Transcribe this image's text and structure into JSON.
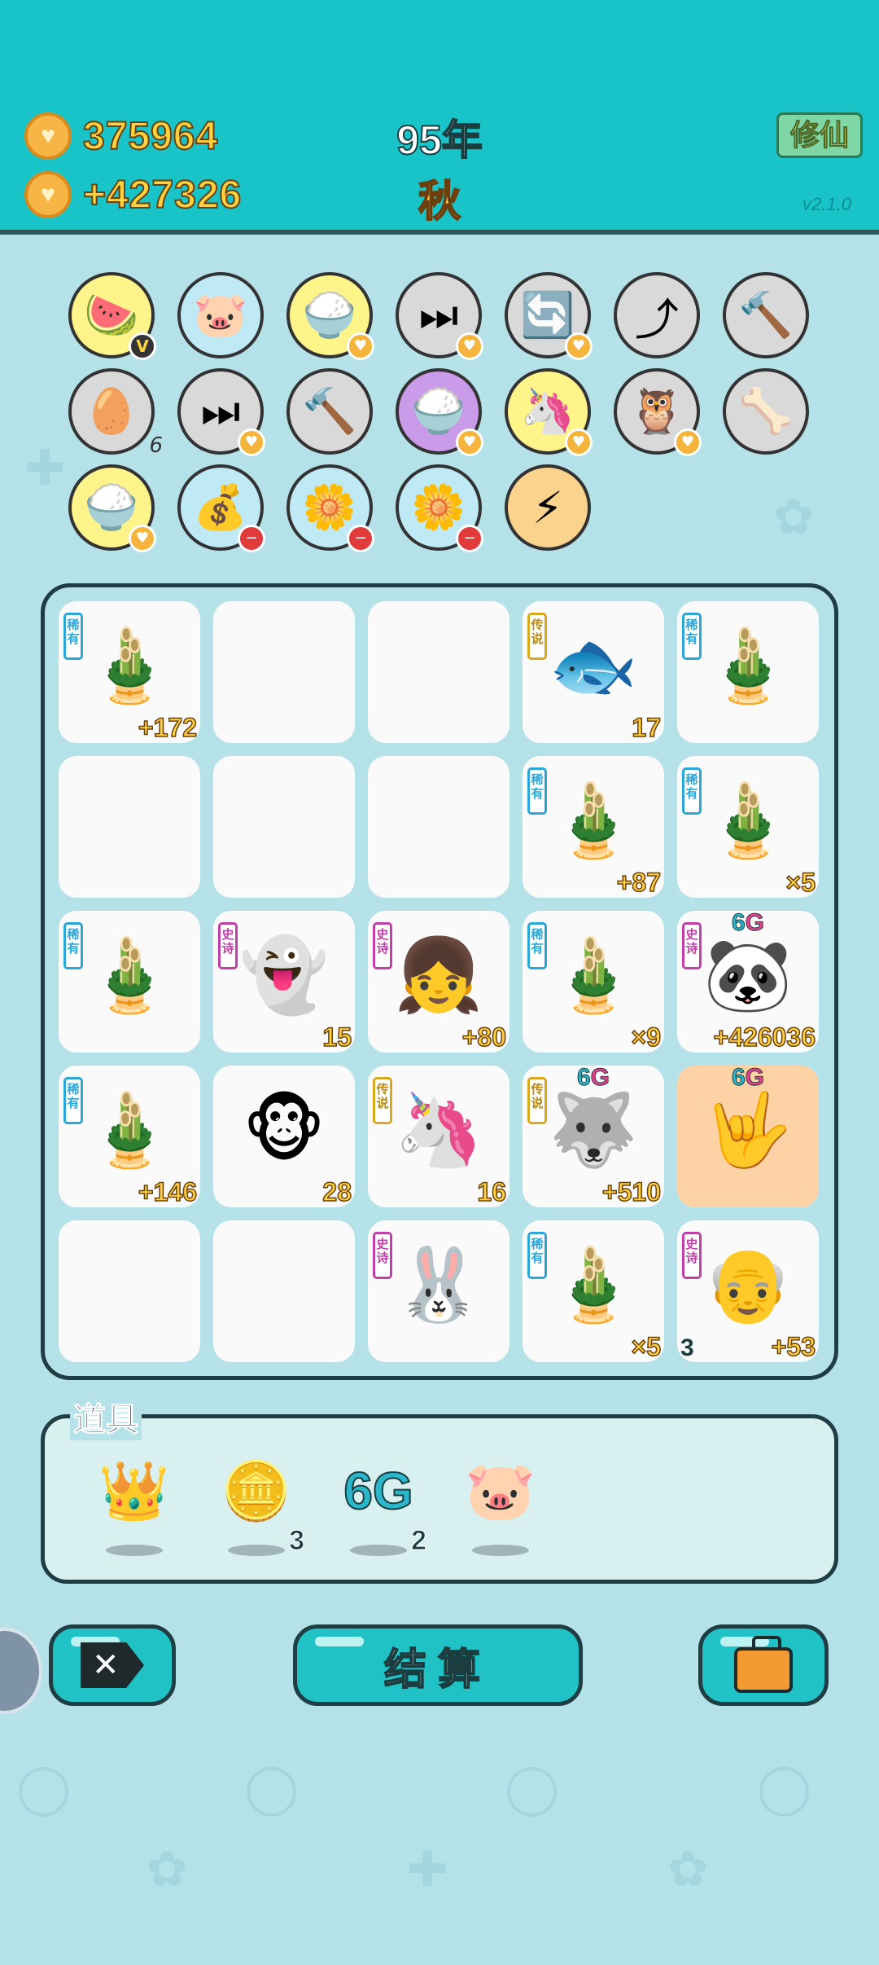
{
  "header": {
    "coins": "375964",
    "income": "+427326",
    "year": "95年",
    "season": "秋",
    "xiuxian_label": "修仙",
    "version": "v2.1.0",
    "coin_icon": "heart-coin-icon"
  },
  "skills": [
    {
      "icon": "fruit-basket-icon",
      "glyph": "🍉",
      "badge": "V"
    },
    {
      "icon": "piggy-bank-icon",
      "glyph": "🐷"
    },
    {
      "icon": "rice-bowl-icon",
      "glyph": "🍚",
      "badge": "♥"
    },
    {
      "icon": "skip-icon",
      "glyph": "⏭",
      "badge": "♥"
    },
    {
      "icon": "refresh-icon",
      "glyph": "🔄",
      "badge": "♥"
    },
    {
      "icon": "upgrade-arrow-icon",
      "glyph": "⤴"
    },
    {
      "icon": "hammer-icon",
      "glyph": "🔨"
    },
    {
      "icon": "egg-tray-icon",
      "glyph": "🥚",
      "count": "6"
    },
    {
      "icon": "skip-icon",
      "glyph": "⏭",
      "badge": "♥"
    },
    {
      "icon": "hammer-icon",
      "glyph": "🔨"
    },
    {
      "icon": "rice-bowl-icon",
      "glyph": "🍚",
      "badge": "♥"
    },
    {
      "icon": "unicorn-icon",
      "glyph": "🦄",
      "badge": "♥"
    },
    {
      "icon": "owl-icon",
      "glyph": "🦉",
      "badge": "♥"
    },
    {
      "icon": "pet-food-icon",
      "glyph": "🦴"
    },
    {
      "icon": "rice-bowl-icon",
      "glyph": "🍚",
      "badge": "♥"
    },
    {
      "icon": "money-bag-icon",
      "glyph": "💰",
      "minus": true
    },
    {
      "icon": "potted-flower-icon",
      "glyph": "🌼",
      "minus": true
    },
    {
      "icon": "potted-flower-icon",
      "glyph": "🌼",
      "minus": true
    },
    {
      "icon": "lightning-icon",
      "glyph": "⚡"
    }
  ],
  "board": [
    [
      {
        "tag": "稀有",
        "rarity": "rare",
        "item": "bamboo",
        "glyph": "🎍",
        "value": "+172"
      },
      {
        "empty": true
      },
      {
        "empty": true
      },
      {
        "tag": "传说",
        "rarity": "legend",
        "item": "koi",
        "glyph": "🐟",
        "value": "17"
      },
      {
        "tag": "稀有",
        "rarity": "rare",
        "item": "bamboo",
        "glyph": "🎍"
      }
    ],
    [
      {
        "empty": true
      },
      {
        "empty": true
      },
      {
        "empty": true
      },
      {
        "tag": "稀有",
        "rarity": "rare",
        "item": "bamboo",
        "glyph": "🎍",
        "value": "+87"
      },
      {
        "tag": "稀有",
        "rarity": "rare",
        "item": "bamboo",
        "glyph": "🎍",
        "value": "×5"
      }
    ],
    [
      {
        "tag": "稀有",
        "rarity": "rare",
        "item": "bamboo",
        "glyph": "🎍"
      },
      {
        "tag": "史诗",
        "rarity": "epic",
        "item": "ghost",
        "glyph": "👻",
        "value": "15"
      },
      {
        "tag": "史诗",
        "rarity": "epic",
        "item": "girl",
        "glyph": "👧",
        "value": "+80"
      },
      {
        "tag": "稀有",
        "rarity": "rare",
        "item": "bamboo",
        "glyph": "🎍",
        "value": "×9"
      },
      {
        "tag": "史诗",
        "rarity": "epic",
        "item": "panda",
        "glyph": "🐼",
        "value": "+426036",
        "sixg": true
      }
    ],
    [
      {
        "tag": "稀有",
        "rarity": "rare",
        "item": "bamboo",
        "glyph": "🎍",
        "value": "+146"
      },
      {
        "item": "monkey",
        "glyph": "🐵",
        "value": "28"
      },
      {
        "tag": "传说",
        "rarity": "legend",
        "item": "unicorn",
        "glyph": "🦄",
        "value": "16"
      },
      {
        "tag": "传说",
        "rarity": "legend",
        "item": "husky-king",
        "glyph": "🐺",
        "value": "+510",
        "sixg": true
      },
      {
        "item": "hand-gesture",
        "glyph": "🤟",
        "sixg": true,
        "highlight": true
      }
    ],
    [
      {
        "empty": true
      },
      {
        "empty": true
      },
      {
        "tag": "史诗",
        "rarity": "epic",
        "item": "rabbit-house",
        "glyph": "🐰"
      },
      {
        "tag": "稀有",
        "rarity": "rare",
        "item": "bamboo",
        "glyph": "🎍",
        "value": "×5"
      },
      {
        "tag": "史诗",
        "rarity": "epic",
        "item": "grandpa",
        "glyph": "👴",
        "value": "+53",
        "sub": "3"
      }
    ]
  ],
  "sixg_label": {
    "six": "6",
    "g": "G"
  },
  "items": {
    "title": "道具",
    "list": [
      {
        "icon": "crown-icon",
        "glyph": "👑"
      },
      {
        "icon": "dollar-coin-icon",
        "glyph": "🪙",
        "count": "3"
      },
      {
        "icon": "six-g-icon",
        "glyph": "6G",
        "count": "2"
      },
      {
        "icon": "piggy-bank-icon",
        "glyph": "🐷"
      }
    ]
  },
  "bottom": {
    "close_icon": "close-tag-icon",
    "settle_label": "结算",
    "bag_icon": "briefcase-icon"
  }
}
